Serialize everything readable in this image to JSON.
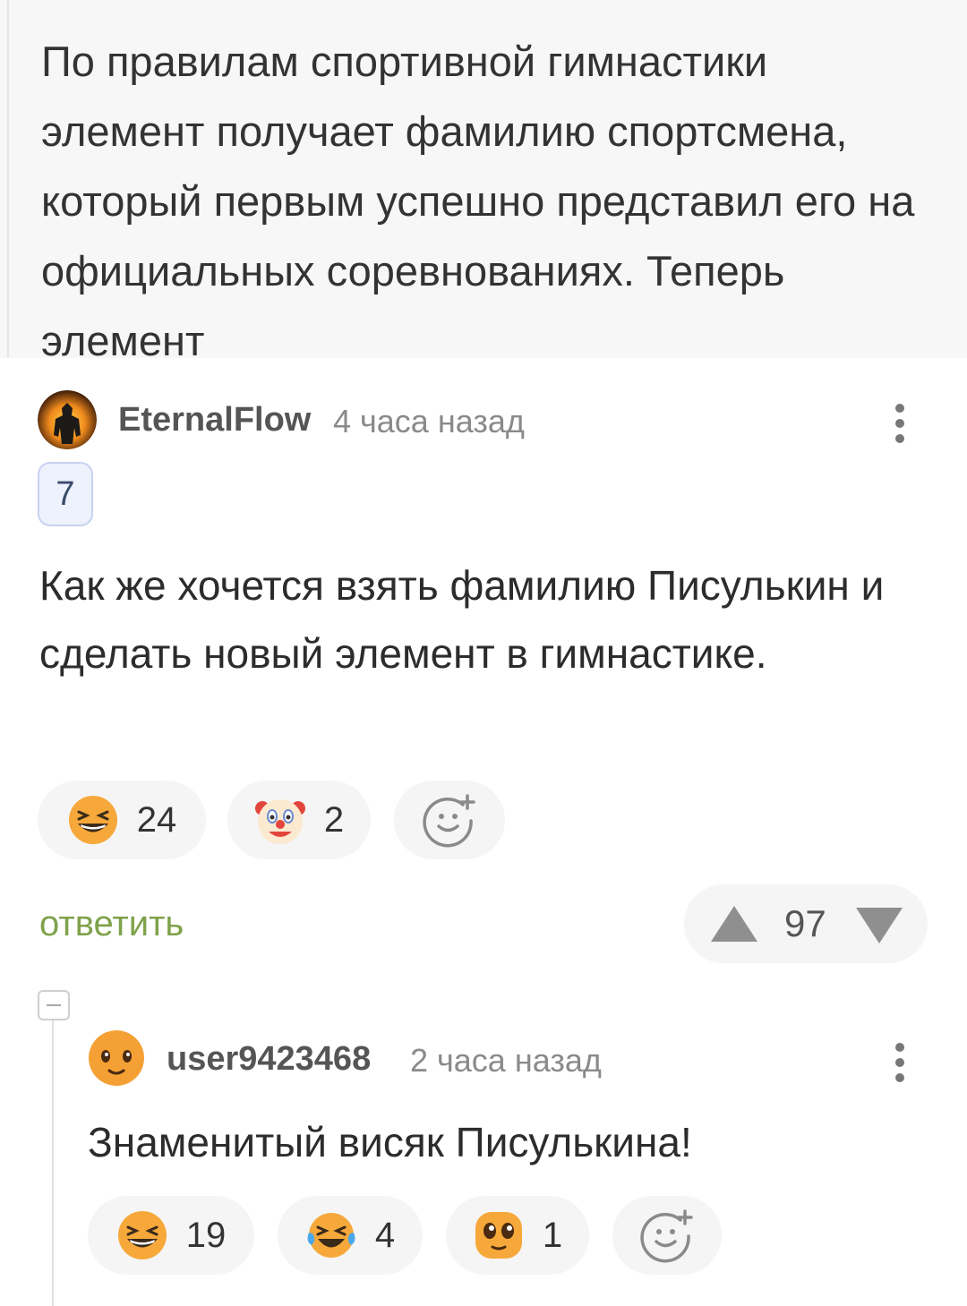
{
  "post": {
    "text": "По правилам спортивной гимнастики элемент получает фамилию спортсмена, который первым успешно представил его на официальных соревнованиях. Теперь элемент"
  },
  "comment1": {
    "username": "EternalFlow",
    "time": "4 часа назад",
    "badge": "7",
    "body": "Как же хочется взять фамилию Писулькин и сделать новый элемент в гимнастике.",
    "reactions": [
      {
        "icon": "grinning-squint-emoji-icon",
        "count": "24"
      },
      {
        "icon": "clown-emoji-icon",
        "count": "2"
      }
    ],
    "add_reaction_icon": "add-reaction-icon",
    "reply_label": "ответить",
    "votes": "97",
    "accent": "#7fa24b"
  },
  "comment2": {
    "username": "user9423468",
    "time": "2 часа назад",
    "body": "Знаменитый висяк Писулькина!",
    "reactions": [
      {
        "icon": "grinning-squint-emoji-icon",
        "count": "19"
      },
      {
        "icon": "tears-of-joy-emoji-icon",
        "count": "4"
      },
      {
        "icon": "pleading-emoji-icon",
        "count": "1"
      }
    ],
    "add_reaction_icon": "add-reaction-icon"
  }
}
